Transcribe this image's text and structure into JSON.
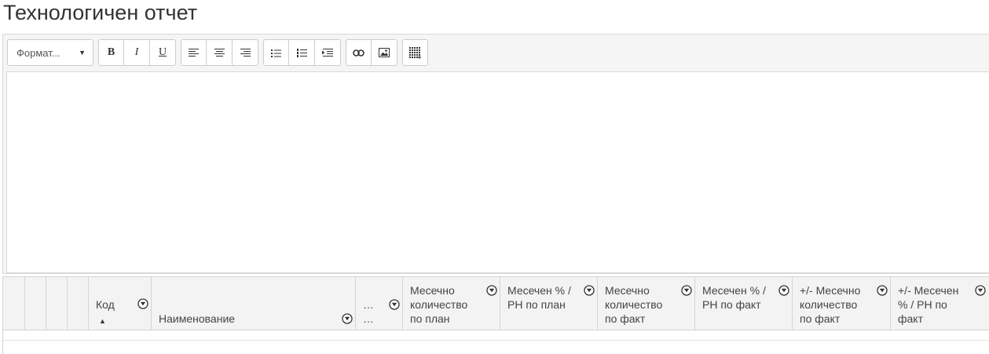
{
  "page": {
    "title": "Технологичен отчет"
  },
  "editor": {
    "format_label": "Формат...",
    "format_caret": "▼",
    "buttons": {
      "bold": "B",
      "italic": "I",
      "underline": "U"
    }
  },
  "grid": {
    "columns": [
      {
        "label": "Код",
        "sorted": "asc",
        "sort_indicator": "▲"
      },
      {
        "label": "Наименование"
      },
      {
        "label": "… …"
      },
      {
        "label": "Месечно количество по план"
      },
      {
        "label": "Месечен % / PH по план"
      },
      {
        "label": "Месечно количество по факт"
      },
      {
        "label": "Месечен % / PH по факт"
      },
      {
        "label": "+/- Месечно количество по факт"
      },
      {
        "label": "+/- Месечен % / PH по факт"
      }
    ]
  }
}
